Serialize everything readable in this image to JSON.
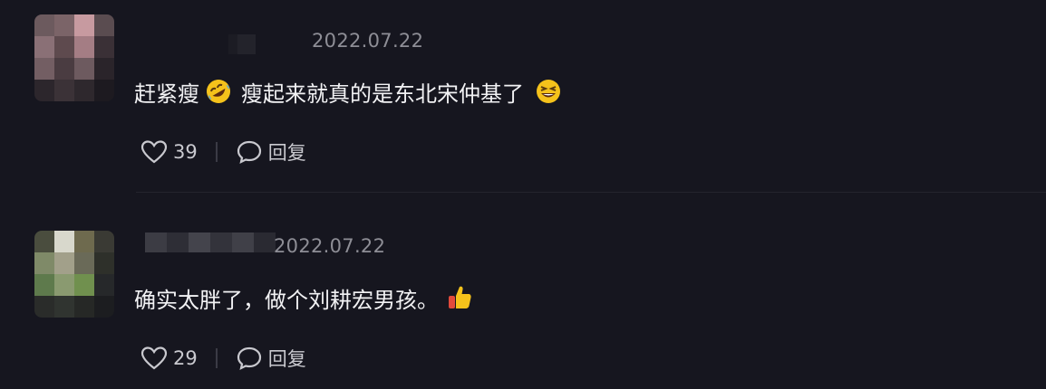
{
  "comments": [
    {
      "date": "2022.07.22",
      "text_before": "赶紧瘦",
      "text_after": "瘦起来就真的是东北宋仲基了",
      "emoji_1": "rolling-on-floor-laughing-emoji",
      "emoji_2": "grinning-squinting-emoji",
      "likes": "39",
      "reply_label": "回复"
    },
    {
      "date": "2022.07.22",
      "text_before": "确实太胖了，做个刘耕宏男孩。",
      "emoji_1": "thumbs-up-emoji",
      "likes": "29",
      "reply_label": "回复"
    }
  ],
  "colors": {
    "background": "#16161f",
    "date_text": "#8e8e96",
    "comment_text": "#f2f2f4",
    "action_text": "#c9c9cf",
    "emoji_yellow": "#f5c21b",
    "emoji_red": "#e24a3b"
  }
}
